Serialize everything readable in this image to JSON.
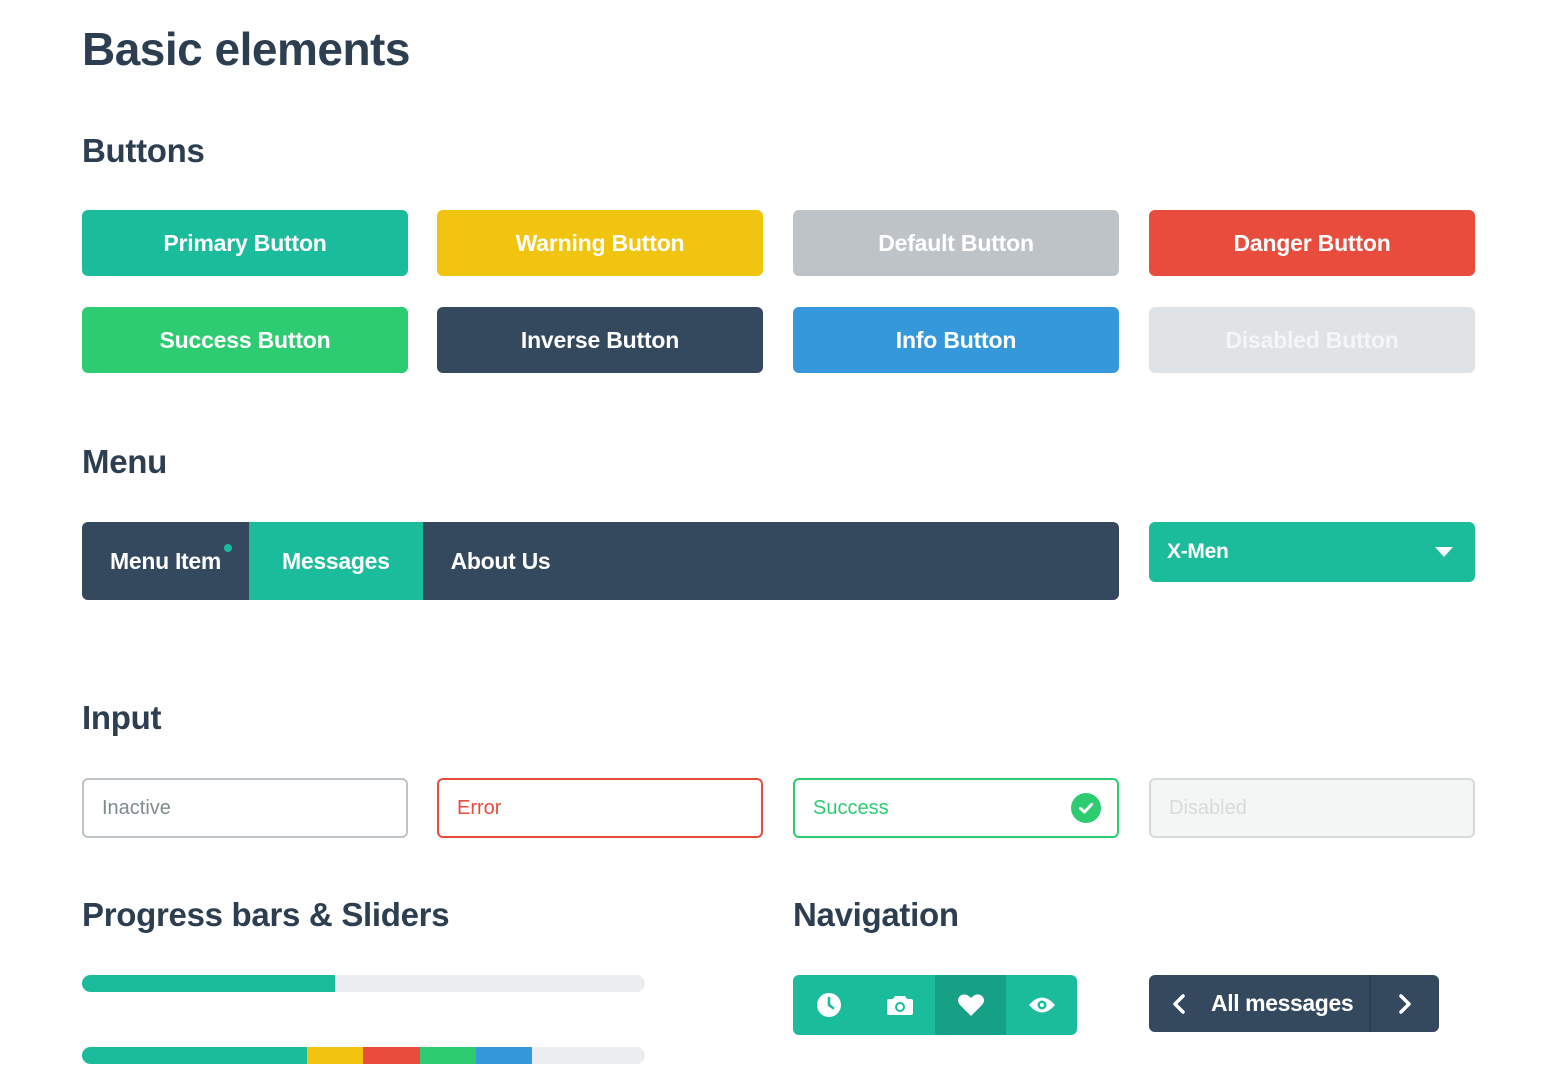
{
  "page_title": "Basic elements",
  "sections": {
    "buttons": "Buttons",
    "menu": "Menu",
    "input": "Input",
    "progress": "Progress bars & Sliders",
    "navigation": "Navigation"
  },
  "buttons": {
    "primary": "Primary Button",
    "warning": "Warning Button",
    "default": "Default Button",
    "danger": "Danger Button",
    "success": "Success Button",
    "inverse": "Inverse Button",
    "info": "Info Button",
    "disabled": "Disabled Button"
  },
  "menu": {
    "items": [
      {
        "label": "Menu Item",
        "badge_dot": true
      },
      {
        "label": "Messages",
        "active": true
      },
      {
        "label": "About Us"
      }
    ],
    "select_value": "X-Men"
  },
  "inputs": {
    "inactive": "Inactive",
    "error": "Error",
    "success": "Success",
    "disabled": "Disabled"
  },
  "progress": {
    "bar1_percent": 45,
    "bar2_segments": [
      {
        "percent": 40,
        "color": "#1abc9c"
      },
      {
        "percent": 10,
        "color": "#f1c40f"
      },
      {
        "percent": 10,
        "color": "#e74c3c"
      },
      {
        "percent": 10,
        "color": "#2ecc71"
      },
      {
        "percent": 10,
        "color": "#3498db"
      }
    ],
    "track_color": "#ebedef"
  },
  "navigation": {
    "group_icons": [
      "clock-icon",
      "camera-icon",
      "heart-icon",
      "eye-icon"
    ],
    "group_active_index": 2,
    "pager_label": "All messages"
  },
  "colors": {
    "turquoise": "#1abc9c",
    "green_sea": "#16a085",
    "emerald": "#2ecc71",
    "sun_flower": "#f1c40f",
    "alizarin": "#e74c3c",
    "peter_river": "#3498db",
    "wet_asphalt": "#34495e",
    "silver": "#bdc3c7"
  }
}
